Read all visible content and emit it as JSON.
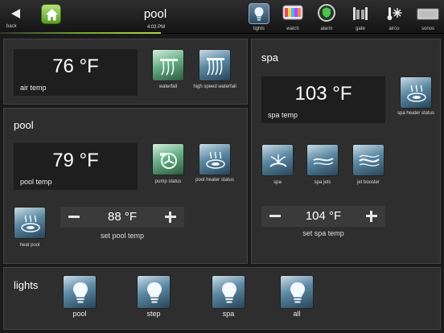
{
  "header": {
    "back_label": "back",
    "title": "pool",
    "time": "4:03 PM",
    "nav": [
      {
        "label": "lights",
        "icon": "lightbulb-icon"
      },
      {
        "label": "watch",
        "icon": "tv-icon"
      },
      {
        "label": "alarm",
        "icon": "shield-icon"
      },
      {
        "label": "gate",
        "icon": "gate-icon"
      },
      {
        "label": "airco",
        "icon": "thermometer-snowflake-icon"
      },
      {
        "label": "sonos",
        "icon": "speaker-icon"
      }
    ]
  },
  "air": {
    "value": "76 °F",
    "label": "air temp",
    "buttons": [
      {
        "label": "waterfall",
        "icon": "waterfall-icon"
      },
      {
        "label": "high speed waterfall",
        "icon": "high-speed-waterfall-icon"
      }
    ]
  },
  "pool": {
    "title": "pool",
    "value": "79 °F",
    "label": "pool temp",
    "buttons": [
      {
        "label": "pump status",
        "icon": "pump-icon"
      },
      {
        "label": "pool heater status",
        "icon": "heater-icon"
      },
      {
        "label": "heat pool",
        "icon": "heat-icon"
      }
    ],
    "setpoint": "88 °F",
    "setpoint_label": "set pool temp"
  },
  "spa": {
    "title": "spa",
    "value": "103 °F",
    "label": "spa temp",
    "heater_label": "spa heater status",
    "buttons": [
      {
        "label": "spa",
        "icon": "spa-icon"
      },
      {
        "label": "spa jets",
        "icon": "jets-icon"
      },
      {
        "label": "jet booster",
        "icon": "booster-icon"
      }
    ],
    "setpoint": "104 °F",
    "setpoint_label": "set spa temp"
  },
  "lights": {
    "title": "lights",
    "items": [
      {
        "label": "pool"
      },
      {
        "label": "step"
      },
      {
        "label": "spa"
      },
      {
        "label": "all"
      }
    ]
  }
}
